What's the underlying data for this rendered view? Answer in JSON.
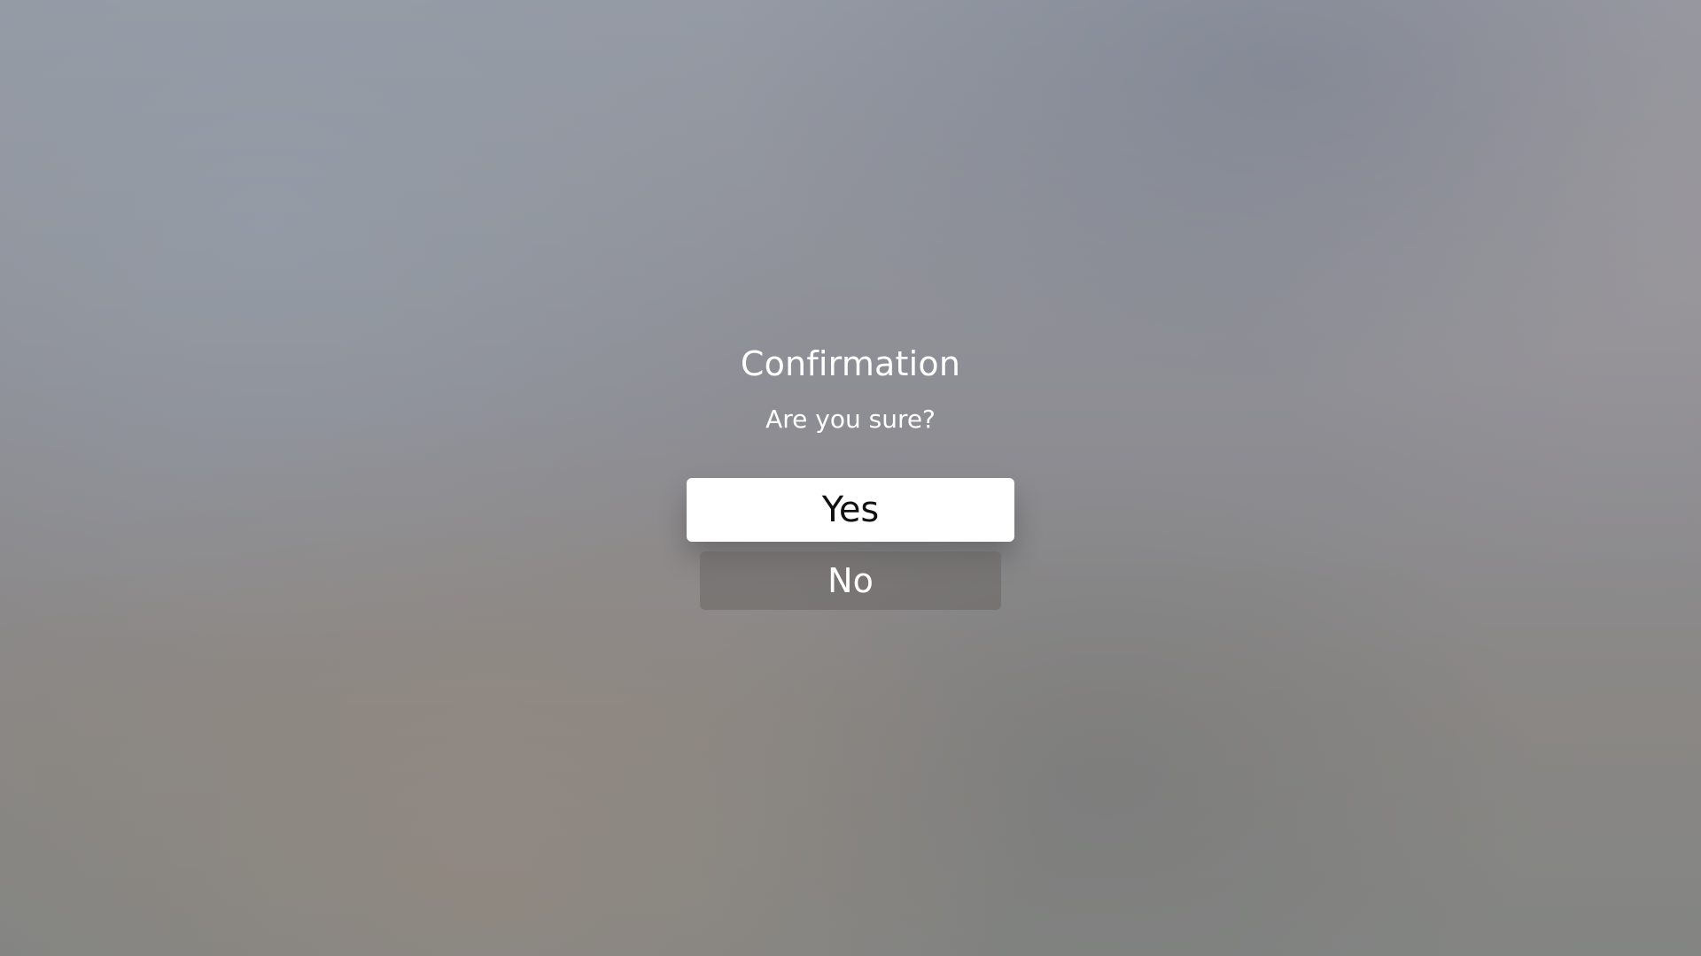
{
  "dialog": {
    "title": "Confirmation",
    "message": "Are you sure?",
    "buttons": [
      {
        "label": "Yes",
        "focused": true
      },
      {
        "label": "No",
        "focused": false
      }
    ]
  },
  "colors": {
    "focused_button_bg": "#ffffff",
    "focused_button_text": "#111111",
    "unfocused_button_text": "#ffffff"
  }
}
